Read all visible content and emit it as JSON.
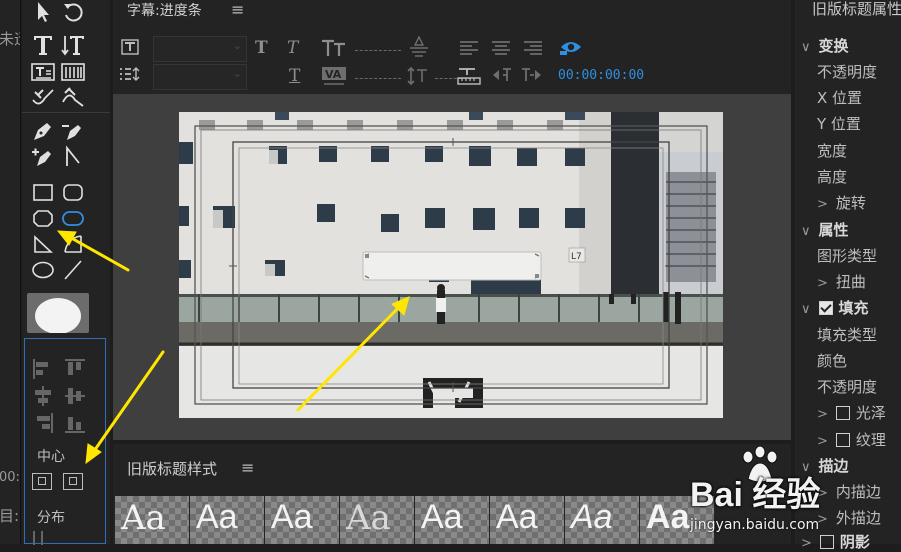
{
  "left_strip": {
    "cut_label_1": "未迂",
    "cut_label_2": "00:",
    "cut_label_3": "目:"
  },
  "main_panel": {
    "title": "字幕:进度条",
    "menu_icon": "hamburger-icon",
    "timecode": "00:00:00:00"
  },
  "align_panel": {
    "center_label": "中心",
    "distribute_label": "分布"
  },
  "right_panel": {
    "title": "旧版标题属性",
    "sections": {
      "transform": "变换",
      "opacity": "不透明度",
      "x_pos": "X 位置",
      "y_pos": "Y 位置",
      "width": "宽度",
      "height": "高度",
      "rotation": "旋转",
      "properties": "属性",
      "shape_type": "图形类型",
      "distort": "扭曲",
      "fill": "填充",
      "fill_type": "填充类型",
      "color": "颜色",
      "fill_opacity": "不透明度",
      "sheen": "光泽",
      "texture": "纹理",
      "stroke": "描边",
      "inner_stroke": "内描边",
      "outer_stroke": "外描边",
      "shadow": "阴影"
    }
  },
  "styles_panel": {
    "title": "旧版标题样式",
    "tiles": [
      "Aa",
      "Aa",
      "Aa",
      "Aa",
      "Aa",
      "Aa",
      "Aa",
      "Aa"
    ]
  },
  "watermark": {
    "text": "Bai 经验",
    "sub": "jingyan.baidu.com"
  },
  "colors": {
    "accent_blue": "#2f8fe0",
    "annotation_yellow": "#ffe600",
    "panel_bg": "#232323"
  }
}
